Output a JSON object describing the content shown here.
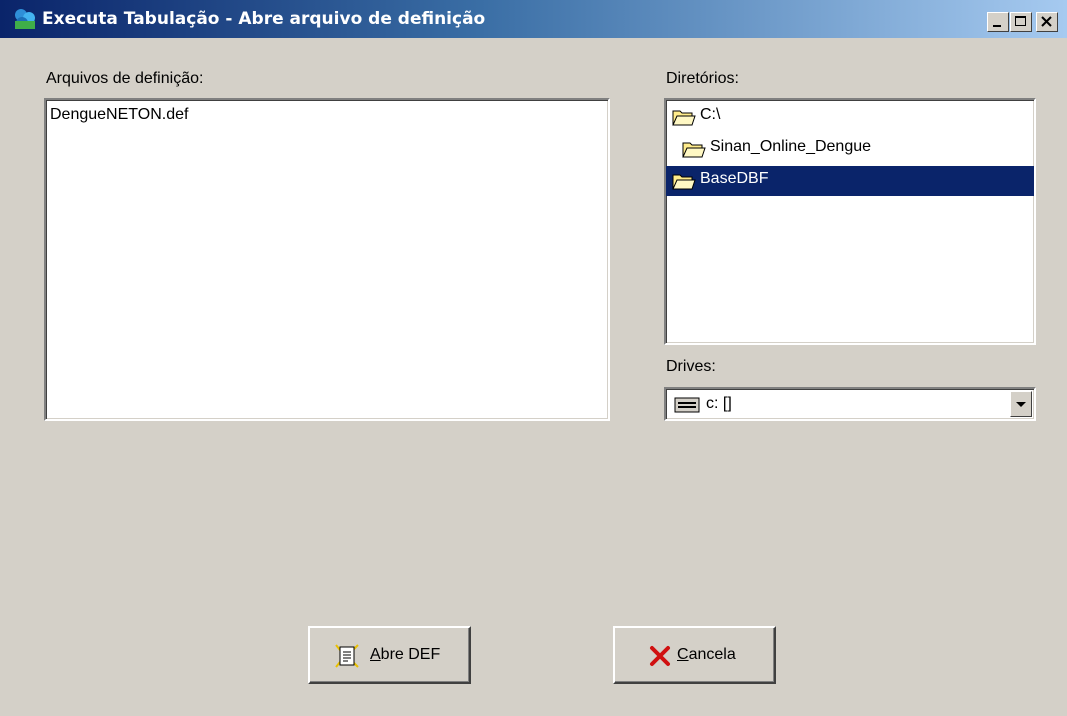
{
  "window": {
    "title": "Executa Tabulação - Abre arquivo de definição"
  },
  "files": {
    "label": "Arquivos de definição:",
    "items": [
      "DengueNETON.def"
    ]
  },
  "directories": {
    "label": "Diretórios:",
    "items": [
      {
        "name": "C:\\",
        "selected": false
      },
      {
        "name": "Sinan_Online_Dengue",
        "selected": false
      },
      {
        "name": "BaseDBF",
        "selected": true
      }
    ]
  },
  "drives": {
    "label": "Drives:",
    "value": "c: []"
  },
  "buttons": {
    "open": {
      "accel": "A",
      "rest": "bre DEF"
    },
    "cancel": {
      "accel": "C",
      "rest": "ancela"
    }
  },
  "colors": {
    "selection": "#0a246a",
    "titlebar_start": "#0a246a",
    "titlebar_end": "#a6caf0",
    "face": "#d4d0c8"
  },
  "icons": {
    "app": "app-icon",
    "minimize": "minimize-icon",
    "maximize": "maximize-icon",
    "close": "close-icon",
    "folder": "folder-icon",
    "drive": "drive-icon",
    "dropdown": "chevron-down-icon",
    "document": "document-icon",
    "cancel": "x-icon"
  }
}
